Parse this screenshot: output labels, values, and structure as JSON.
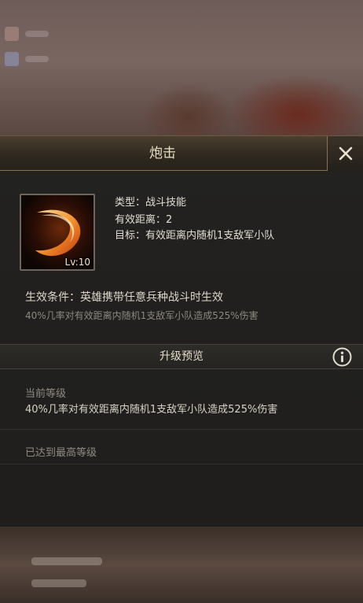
{
  "dialog": {
    "title": "炮击"
  },
  "skill": {
    "level_label": "Lv:10",
    "type_line": "类型：战斗技能",
    "range_line": "有效距离：2",
    "target_line": "目标：有效距离内随机1支敌军小队",
    "condition_line": "生效条件：英雄携带任意兵种战斗时生效",
    "effect_line": "40%几率对有效距离内随机1支敌军小队造成525%伤害"
  },
  "upgrade": {
    "header": "升级预览",
    "current_label": "当前等级",
    "current_effect": "40%几率对有效距离内随机1支敌军小队造成525%伤害",
    "max_label": "已达到最高等级"
  },
  "icons": {
    "close": "close-icon",
    "info": "info-icon",
    "skill": "cannon-strike-skill-icon"
  },
  "colors": {
    "panel": "#1f1e1c",
    "gold_border": "#8a7350",
    "text_primary": "#e2ddd4",
    "text_muted": "#8d8880"
  }
}
